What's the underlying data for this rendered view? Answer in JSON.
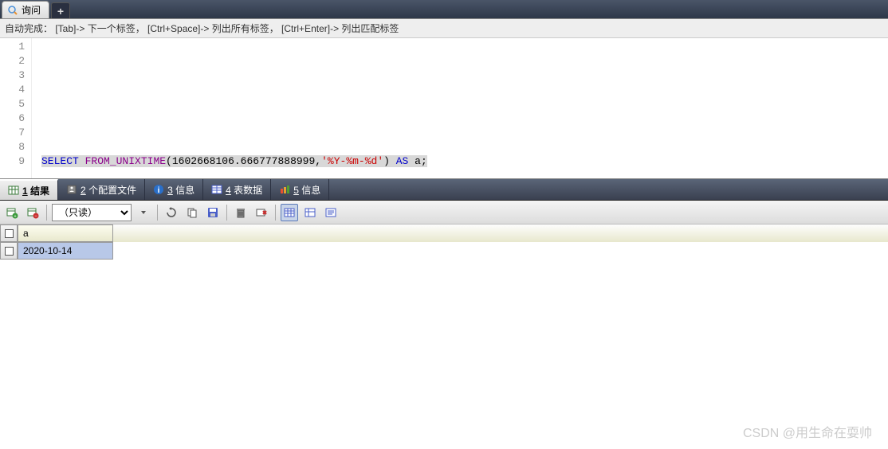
{
  "tab": {
    "title": "询问"
  },
  "hint": "自动完成：  [Tab]-> 下一个标签， [Ctrl+Space]-> 列出所有标签， [Ctrl+Enter]-> 列出匹配标签",
  "editor": {
    "lines": [
      "1",
      "2",
      "3",
      "4",
      "5",
      "6",
      "7",
      "8",
      "9"
    ],
    "sql": {
      "select": "SELECT",
      "fn": "FROM_UNIXTIME",
      "open": "(",
      "arg1": "1602668106.666777888999",
      "comma": ",",
      "arg2": "'%Y-%m-%d'",
      "close": ")",
      "as": "AS",
      "alias": "a",
      "semi": ";"
    }
  },
  "resultTabs": {
    "t1": {
      "num": "1",
      "label": "结果"
    },
    "t2": {
      "num": "2",
      "label": "个配置文件"
    },
    "t3": {
      "num": "3",
      "label": "信息"
    },
    "t4": {
      "num": "4",
      "label": "表数据"
    },
    "t5": {
      "num": "5",
      "label": "信息"
    }
  },
  "toolbar": {
    "mode": "（只读）"
  },
  "grid": {
    "header": "a",
    "value": "2020-10-14"
  },
  "watermark": "CSDN @用生命在耍帅"
}
